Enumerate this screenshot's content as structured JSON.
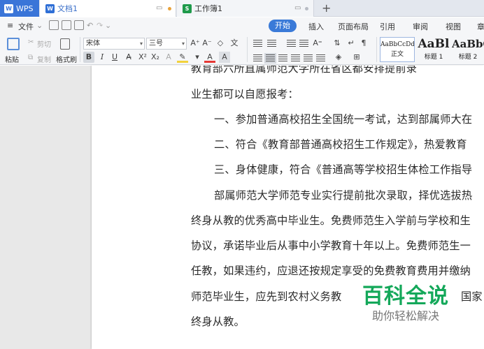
{
  "tabs": {
    "wps": {
      "label": "WPS",
      "icon": "wps-logo-icon"
    },
    "document": {
      "label": "文档1",
      "icon": "writer-doc-icon"
    },
    "spreadsheet": {
      "label": "工作簿1",
      "icon": "spreadsheet-icon"
    },
    "add": "+"
  },
  "menu": {
    "file": "文件",
    "ribbon_tabs": [
      "开始",
      "插入",
      "页面布局",
      "引用",
      "审阅",
      "视图",
      "章"
    ]
  },
  "ribbon": {
    "paste": "粘贴",
    "cut": "剪切",
    "copy": "复制",
    "format_painter": "格式刷",
    "font_name": "宋体",
    "font_size": "三号",
    "styles": [
      {
        "preview": "AaBbCcDd",
        "name": "正文"
      },
      {
        "preview": "AaBl",
        "name": "标题 1"
      },
      {
        "preview": "AaBbC",
        "name": "标题 2"
      }
    ]
  },
  "document": {
    "paragraphs": [
      "教育部六所直属师范大学所在省区都安排提前录",
      "业生都可以自愿报考：",
      "一、参加普通高校招生全国统一考试，达到部属师大在",
      "二、符合《教育部普通高校招生工作规定》，热爱教育",
      "三、身体健康，符合《普通高等学校招生体检工作指导",
      "部属师范大学师范专业实行提前批次录取，择优选拔热",
      "终身从教的优秀高中毕业生。免费师范生入学前与学校和生",
      "协议，承诺毕业后从事中小学教育十年以上。免费师范生一",
      "任教，如果违约，应退还按规定享受的免费教育费用并缴纳",
      "师范毕业生，应先到农村义务教",
      "终身从教。"
    ],
    "paragraph_tail_right": "国家"
  },
  "watermark": {
    "title": "百科全说",
    "subtitle": "助你轻松解决"
  },
  "colors": {
    "accent": "#3a7ad8",
    "watermark_green": "#14a85a"
  }
}
